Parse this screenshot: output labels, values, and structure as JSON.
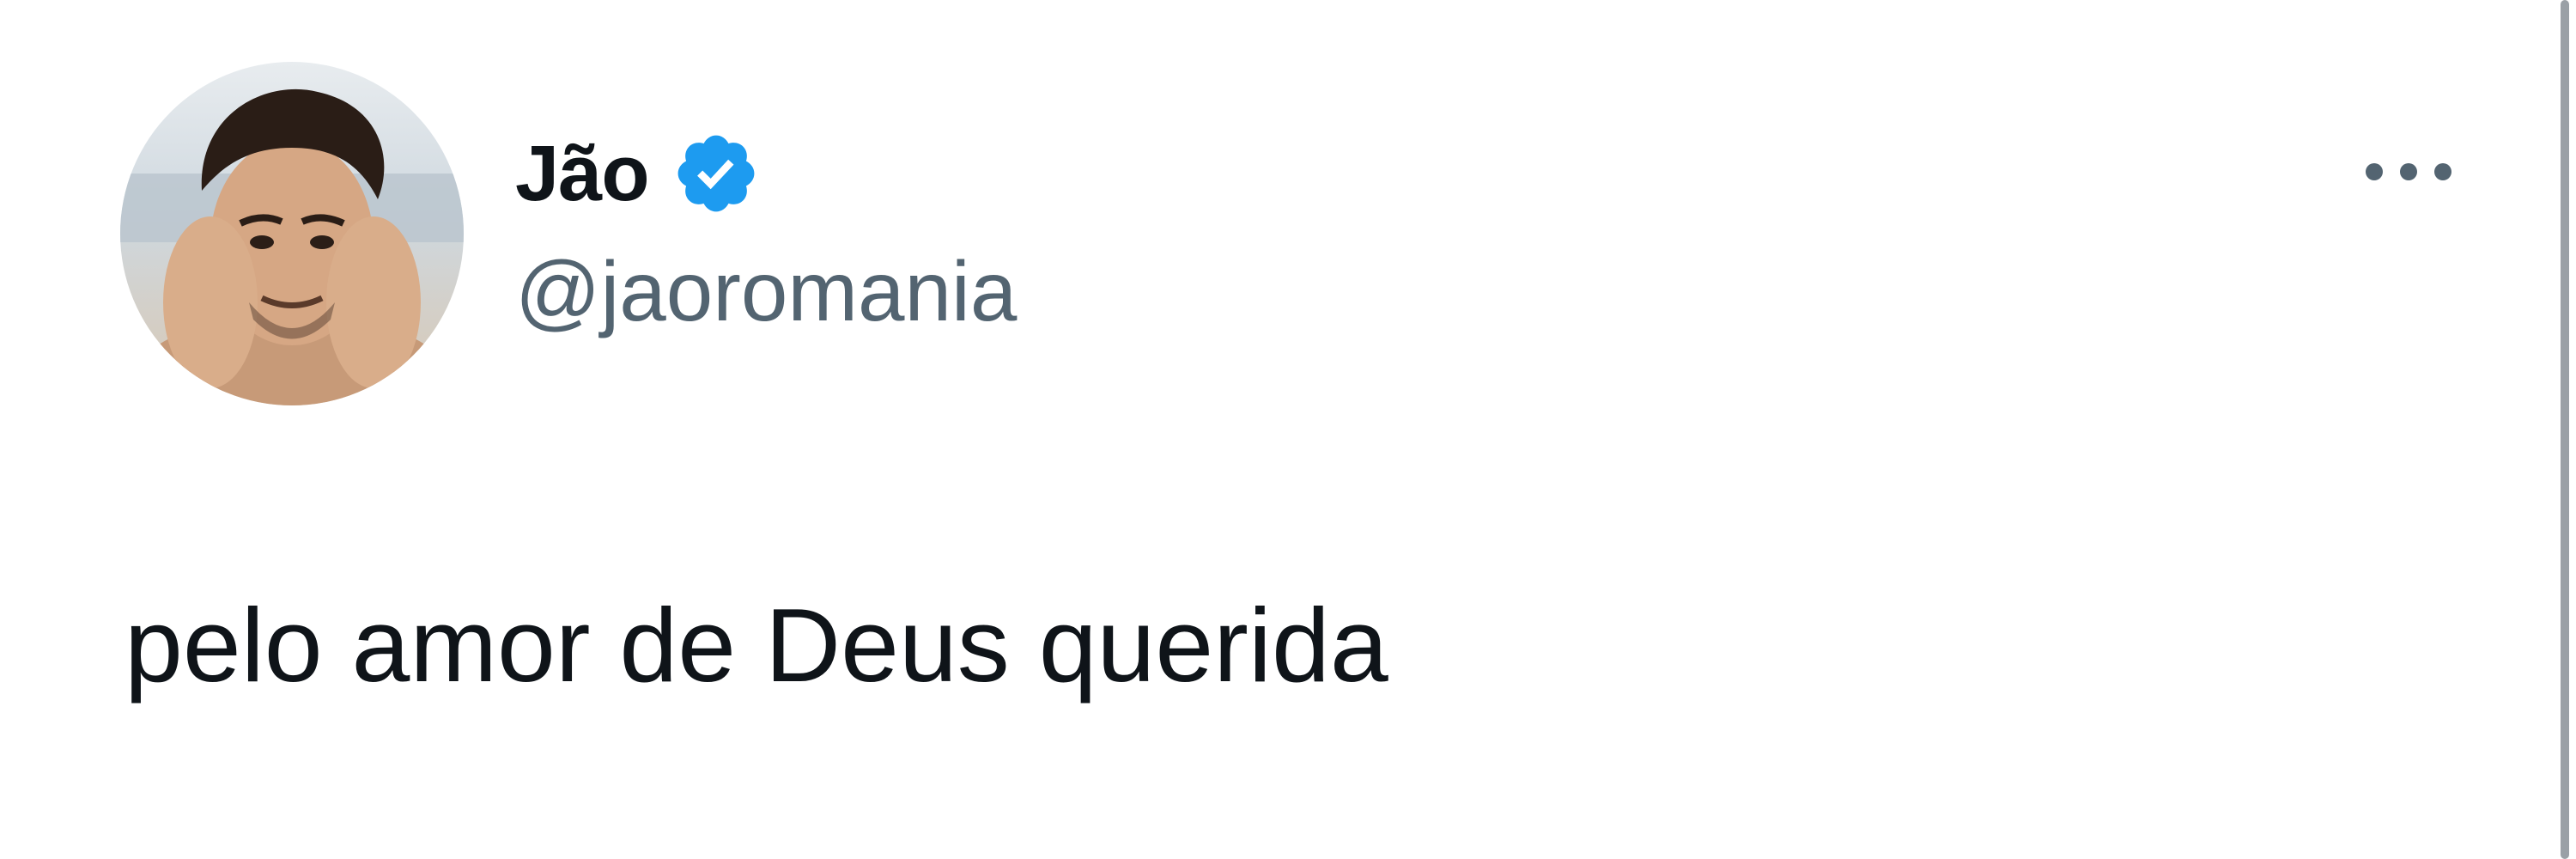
{
  "tweet": {
    "author": {
      "display_name": "Jão",
      "handle": "@jaoromania",
      "verified": true,
      "avatar_icon": "user-avatar-photo"
    },
    "text": "pelo amor de Deus querida",
    "more_icon": "more-horizontal-icon"
  },
  "colors": {
    "background": "#ffffff",
    "text_primary": "#0f1419",
    "text_secondary": "#536471",
    "verified_badge": "#1d9bf0"
  }
}
